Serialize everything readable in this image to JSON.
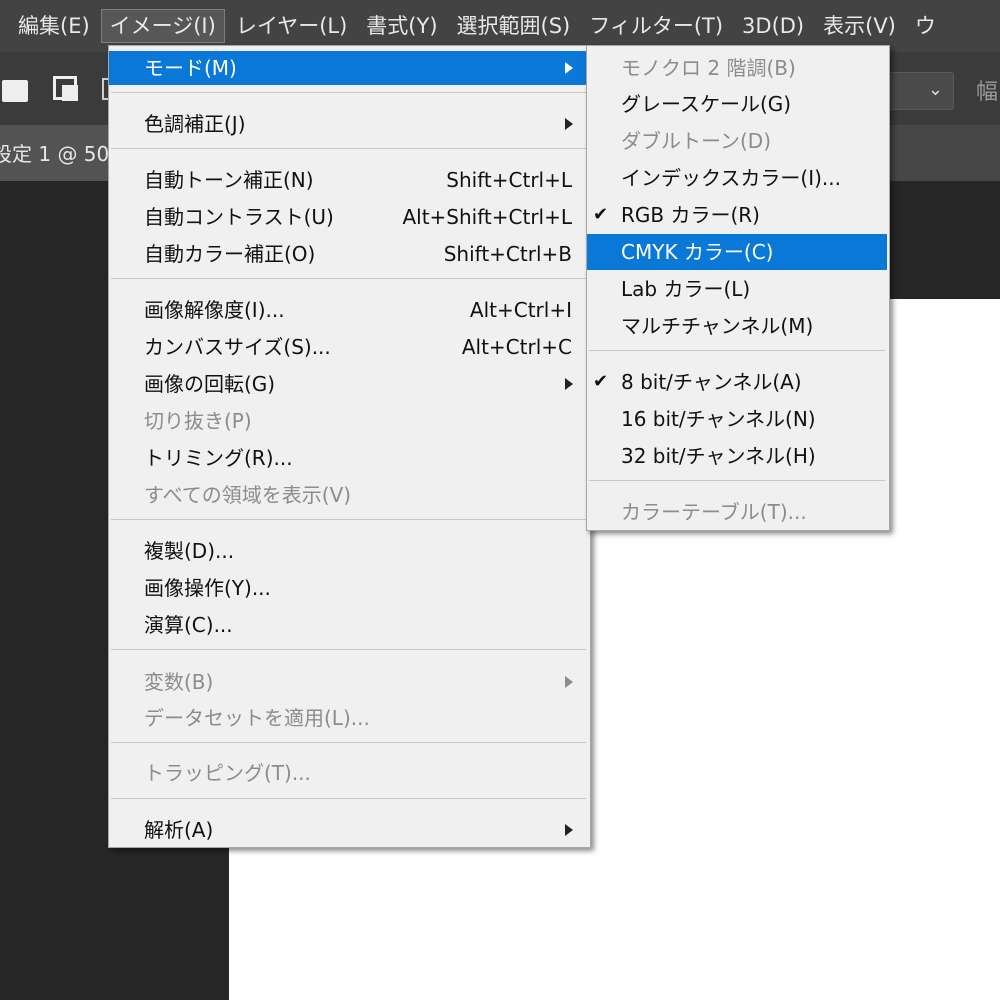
{
  "menubar": {
    "items": [
      {
        "label": "編集(E)"
      },
      {
        "label": "イメージ(I)"
      },
      {
        "label": "レイヤー(L)"
      },
      {
        "label": "書式(Y)"
      },
      {
        "label": "選択範囲(S)"
      },
      {
        "label": "フィルター(T)"
      },
      {
        "label": "3D(D)"
      },
      {
        "label": "表示(V)"
      },
      {
        "label": "ウ"
      }
    ]
  },
  "optionsbar": {
    "width_label": "幅"
  },
  "document": {
    "tab_label": "設定 1 @ 50"
  },
  "image_menu": {
    "mode": {
      "label": "モード(M)"
    },
    "adjustments": {
      "label": "色調補正(J)"
    },
    "auto_tone": {
      "label": "自動トーン補正(N)",
      "shortcut": "Shift+Ctrl+L"
    },
    "auto_contrast": {
      "label": "自動コントラスト(U)",
      "shortcut": "Alt+Shift+Ctrl+L"
    },
    "auto_color": {
      "label": "自動カラー補正(O)",
      "shortcut": "Shift+Ctrl+B"
    },
    "image_size": {
      "label": "画像解像度(I)...",
      "shortcut": "Alt+Ctrl+I"
    },
    "canvas_size": {
      "label": "カンバスサイズ(S)...",
      "shortcut": "Alt+Ctrl+C"
    },
    "image_rotation": {
      "label": "画像の回転(G)"
    },
    "crop": {
      "label": "切り抜き(P)"
    },
    "trim": {
      "label": "トリミング(R)..."
    },
    "reveal_all": {
      "label": "すべての領域を表示(V)"
    },
    "duplicate": {
      "label": "複製(D)..."
    },
    "apply_image": {
      "label": "画像操作(Y)..."
    },
    "calculations": {
      "label": "演算(C)..."
    },
    "variables": {
      "label": "変数(B)"
    },
    "apply_data_set": {
      "label": "データセットを適用(L)..."
    },
    "trap": {
      "label": "トラッピング(T)..."
    },
    "analysis": {
      "label": "解析(A)"
    }
  },
  "mode_submenu": {
    "bitmap": {
      "label": "モノクロ 2 階調(B)"
    },
    "grayscale": {
      "label": "グレースケール(G)"
    },
    "duotone": {
      "label": "ダブルトーン(D)"
    },
    "indexed": {
      "label": "インデックスカラー(I)..."
    },
    "rgb": {
      "label": "RGB カラー(R)",
      "checked": true
    },
    "cmyk": {
      "label": "CMYK カラー(C)"
    },
    "lab": {
      "label": "Lab カラー(L)"
    },
    "multichannel": {
      "label": "マルチチャンネル(M)"
    },
    "bit8": {
      "label": "8 bit/チャンネル(A)",
      "checked": true
    },
    "bit16": {
      "label": "16 bit/チャンネル(N)"
    },
    "bit32": {
      "label": "32 bit/チャンネル(H)"
    },
    "color_table": {
      "label": "カラーテーブル(T)..."
    }
  },
  "glyphs": {
    "checkmark": "✔",
    "chevron_down": "⌄"
  },
  "colors": {
    "menu_bg": "#f0f0f0",
    "highlight": "#0a78d7",
    "disabled_text": "#8c8c8c",
    "app_bg": "#262626",
    "menubar_bg": "#434343"
  }
}
